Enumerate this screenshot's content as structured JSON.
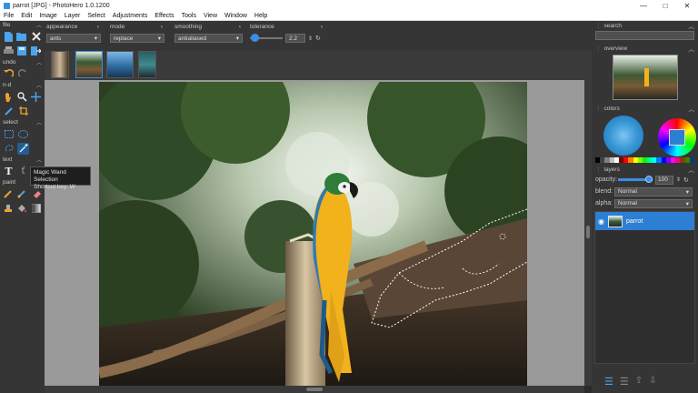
{
  "window": {
    "title": "parrot [JPG] - PhotoHero 1.0.1200",
    "controls": [
      "—",
      "□",
      "✕"
    ]
  },
  "menu": [
    "File",
    "Edit",
    "Image",
    "Layer",
    "Select",
    "Adjustments",
    "Effects",
    "Tools",
    "View",
    "Window",
    "Help"
  ],
  "left_panel": {
    "sections": {
      "file": "file",
      "undo": "undo",
      "nd": "n-d",
      "select": "select",
      "text": "text",
      "paint": "paint"
    }
  },
  "options": {
    "appearance": {
      "label": "appearance",
      "value": "ants"
    },
    "mode": {
      "label": "mode",
      "value": "replace"
    },
    "smoothing": {
      "label": "smoothing",
      "value": "antialiased"
    },
    "tolerance": {
      "label": "tolerance",
      "value": "2.2",
      "level": 0.05
    }
  },
  "tooltip": {
    "title": "Magic Wand Selection",
    "shortcut": "Shortcut key: W"
  },
  "right_panel": {
    "search": {
      "label": "search",
      "placeholder": ""
    },
    "overview": {
      "label": "overview"
    },
    "colors": {
      "label": "colors"
    },
    "layers": {
      "label": "layers",
      "opacity_label": "opacity:",
      "opacity_value": "100",
      "blend_label": "blend:",
      "blend_value": "Normal",
      "alpha_label": "alpha:",
      "alpha_value": "Normal",
      "layer_name": "parrot"
    }
  },
  "colors": {
    "accent": "#3a8ee6",
    "panel": "#353535",
    "canvas_bg": "#9a9a9a",
    "layer_selected": "#2d7fd3",
    "parrot_blue": "#2e7ab5",
    "parrot_yellow": "#f2b21c"
  },
  "palette": [
    "#000000",
    "#404040",
    "#808080",
    "#c0c0c0",
    "#ffffff",
    "#7f0000",
    "#ff0000",
    "#ff7f00",
    "#ffff00",
    "#7fff00",
    "#00ff00",
    "#00ff7f",
    "#00ffff",
    "#007fff",
    "#0000ff",
    "#7f00ff",
    "#ff00ff",
    "#ff007f",
    "#7f3f00",
    "#3f7f00",
    "#003f7f"
  ]
}
